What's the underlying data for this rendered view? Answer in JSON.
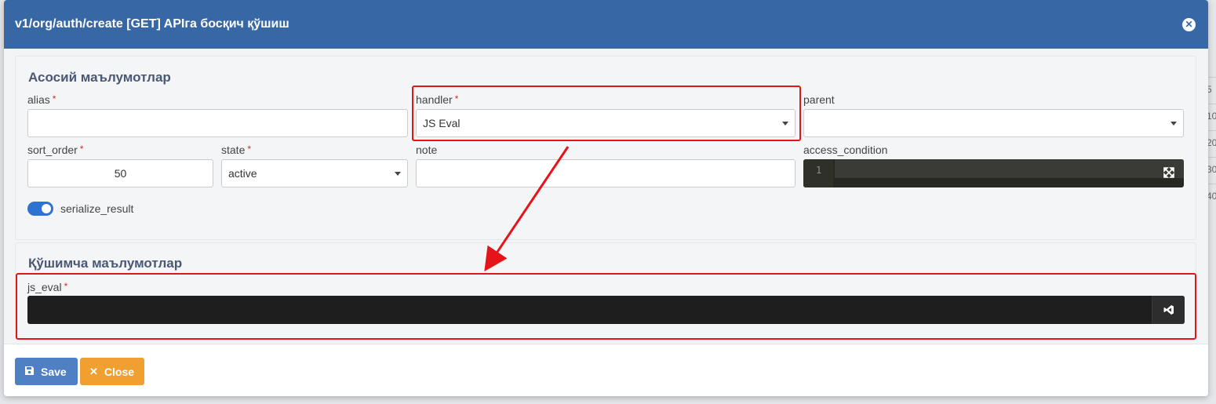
{
  "modal": {
    "title": "v1/org/auth/create [GET] APIга босқич қўшиш"
  },
  "section_main": {
    "title": "Асосий маълумотлар",
    "fields": {
      "alias": {
        "label": "alias",
        "value": ""
      },
      "handler": {
        "label": "handler",
        "value": "JS Eval"
      },
      "parent": {
        "label": "parent",
        "value": ""
      },
      "sort_order": {
        "label": "sort_order",
        "value": "50"
      },
      "state": {
        "label": "state",
        "value": "active"
      },
      "note": {
        "label": "note",
        "value": ""
      },
      "access_condition": {
        "label": "access_condition",
        "line_number": "1"
      }
    },
    "toggle": {
      "label": "serialize_result",
      "checked": true
    }
  },
  "section_extra": {
    "title": "Қўшимча маълумотлар",
    "js_eval": {
      "label": "js_eval"
    }
  },
  "required_marker": "*",
  "footer": {
    "save_label": "Save",
    "close_label": "Close"
  },
  "background": {
    "cells": [
      "5",
      "10",
      "20",
      "30",
      "40"
    ]
  },
  "colors": {
    "header": "#3768a5",
    "save": "#4f80c4",
    "close": "#f0a030",
    "highlight": "#e5141b",
    "toggle": "#2c73d2"
  },
  "icons": {
    "close": "close-circle-icon",
    "caret": "caret-down-icon",
    "expand": "expand-icon",
    "vscode": "vscode-icon",
    "save": "floppy-icon",
    "cancel": "x-icon"
  }
}
